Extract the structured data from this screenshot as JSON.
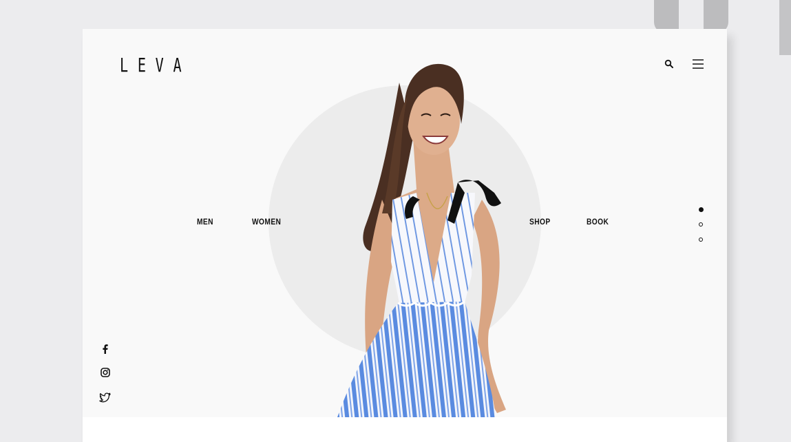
{
  "brand": {
    "logo": "LEVA"
  },
  "nav": {
    "left": [
      "MEN",
      "WOMEN"
    ],
    "right": [
      "SHOP",
      "BOOK"
    ]
  },
  "header": {
    "icons": [
      "search-icon",
      "hamburger-menu-icon"
    ]
  },
  "slider": {
    "count": 3,
    "active_index": 0
  },
  "social": [
    "facebook-icon",
    "instagram-icon",
    "twitter-icon"
  ],
  "colors": {
    "background": "#ececee",
    "card": "#f9f9f9",
    "circle": "#ececec",
    "text": "#111111",
    "dress_stripe": "#5a8be0"
  }
}
